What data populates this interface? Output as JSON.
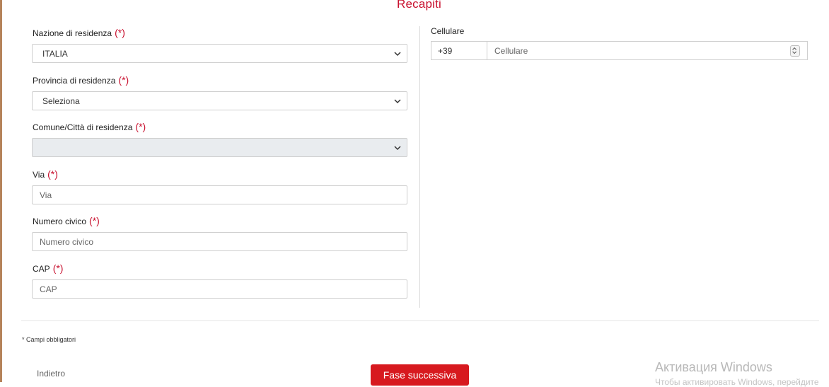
{
  "section_title": "Recapiti",
  "required_mark": "(*)",
  "fields": {
    "nazione": {
      "label": "Nazione di residenza",
      "value": "ITALIA"
    },
    "provincia": {
      "label": "Provincia di residenza",
      "value": "Seleziona"
    },
    "comune": {
      "label": "Comune/Città di residenza",
      "value": ""
    },
    "via": {
      "label": "Via",
      "placeholder": "Via"
    },
    "civico": {
      "label": "Numero civico",
      "placeholder": "Numero civico"
    },
    "cap": {
      "label": "CAP",
      "placeholder": "CAP"
    }
  },
  "phone": {
    "label": "Cellulare",
    "prefix": "+39",
    "placeholder": "Cellulare"
  },
  "required_note": "* Campi obbligatori",
  "back_label": "Indietro",
  "next_label": "Fase successiva",
  "watermark": {
    "title": "Активация Windows",
    "subtitle": "Чтобы активировать Windows, перейдите"
  },
  "icons": {
    "chevron": "chevron-down-icon",
    "spinner": "spinner-updown-icon"
  }
}
